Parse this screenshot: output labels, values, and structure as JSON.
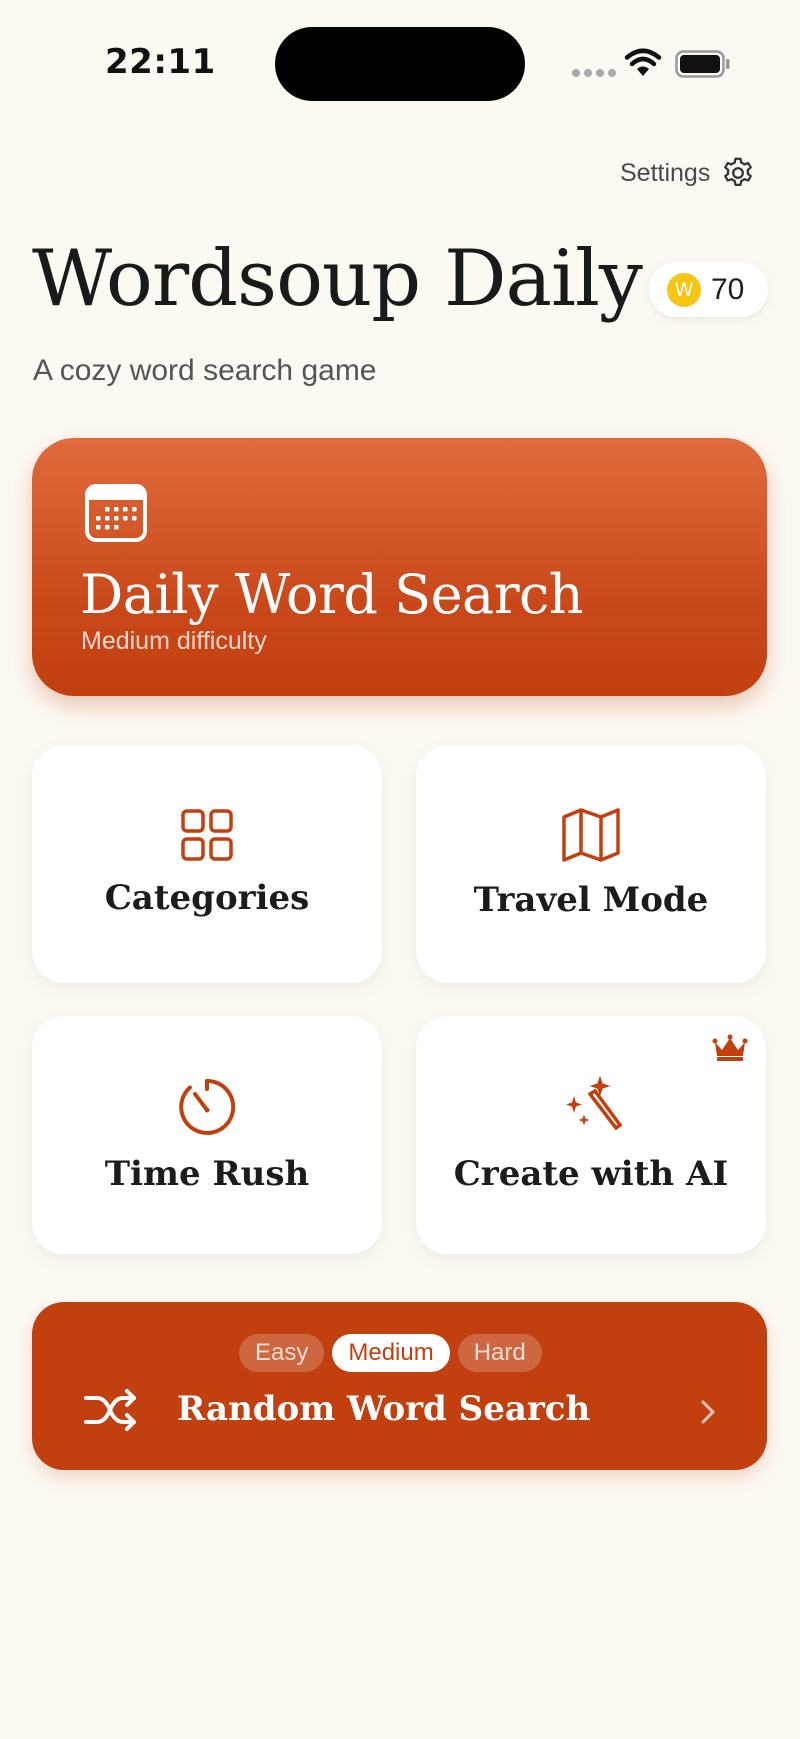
{
  "status_bar": {
    "time": "22:11"
  },
  "header": {
    "settings_label": "Settings",
    "title": "Wordsoup Daily",
    "subtitle": "A cozy word search game",
    "coin_letter": "W",
    "coin_count": "70"
  },
  "daily": {
    "title": "Daily Word Search",
    "difficulty": "Medium difficulty"
  },
  "modes": [
    {
      "label": "Categories",
      "icon": "grid-icon"
    },
    {
      "label": "Travel Mode",
      "icon": "map-icon"
    },
    {
      "label": "Time Rush",
      "icon": "timer-icon"
    },
    {
      "label": "Create with AI",
      "icon": "magic-wand-icon",
      "badge": "crown-icon"
    }
  ],
  "random": {
    "label": "Random Word Search",
    "difficulties": [
      "Easy",
      "Medium",
      "Hard"
    ],
    "selected": "Medium"
  },
  "colors": {
    "background": "#fcf9f3",
    "accent": "#c2400f",
    "accent_light": "#e06b3c",
    "coin": "#f6c613"
  }
}
